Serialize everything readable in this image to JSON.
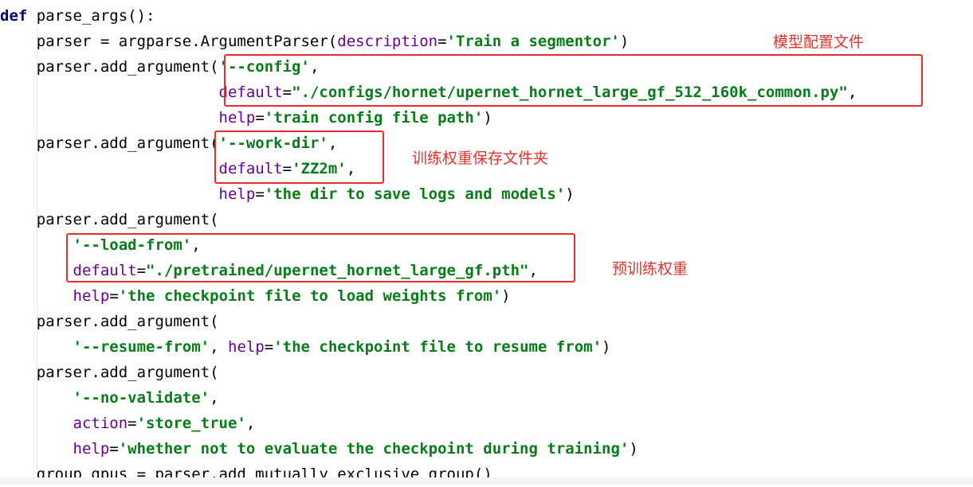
{
  "code_lines": [
    [
      {
        "t": "def",
        "c": "kw"
      },
      {
        "t": " parse_args():",
        "c": "plain"
      }
    ],
    [
      {
        "t": "    parser = argparse.ArgumentParser(",
        "c": "plain"
      },
      {
        "t": "description",
        "c": "kwarg"
      },
      {
        "t": "=",
        "c": "plain"
      },
      {
        "t": "'Train a segmentor'",
        "c": "str"
      },
      {
        "t": ")",
        "c": "plain"
      }
    ],
    [
      {
        "t": "    parser.add_argument(",
        "c": "plain"
      },
      {
        "t": "'--config'",
        "c": "str"
      },
      {
        "t": ",",
        "c": "plain"
      }
    ],
    [
      {
        "t": "                        ",
        "c": "plain"
      },
      {
        "t": "default",
        "c": "kwarg"
      },
      {
        "t": "=",
        "c": "plain"
      },
      {
        "t": "\"./configs/hornet/upernet_hornet_large_gf_512_160k_common.py\"",
        "c": "str"
      },
      {
        "t": ",",
        "c": "plain"
      }
    ],
    [
      {
        "t": "                        ",
        "c": "plain"
      },
      {
        "t": "help",
        "c": "kwarg"
      },
      {
        "t": "=",
        "c": "plain"
      },
      {
        "t": "'train config file path'",
        "c": "str"
      },
      {
        "t": ")",
        "c": "plain"
      }
    ],
    [
      {
        "t": "    parser.add_argument(",
        "c": "plain"
      },
      {
        "t": "'--work-dir'",
        "c": "str"
      },
      {
        "t": ",",
        "c": "plain"
      }
    ],
    [
      {
        "t": "                        ",
        "c": "plain"
      },
      {
        "t": "default",
        "c": "kwarg"
      },
      {
        "t": "=",
        "c": "plain"
      },
      {
        "t": "'ZZ2m'",
        "c": "str"
      },
      {
        "t": ",",
        "c": "plain"
      }
    ],
    [
      {
        "t": "                        ",
        "c": "plain"
      },
      {
        "t": "help",
        "c": "kwarg"
      },
      {
        "t": "=",
        "c": "plain"
      },
      {
        "t": "'the dir to save logs and models'",
        "c": "str"
      },
      {
        "t": ")",
        "c": "plain"
      }
    ],
    [
      {
        "t": "    parser.add_argument(",
        "c": "plain"
      }
    ],
    [
      {
        "t": "        ",
        "c": "plain"
      },
      {
        "t": "'--load-from'",
        "c": "str"
      },
      {
        "t": ",",
        "c": "plain"
      }
    ],
    [
      {
        "t": "        ",
        "c": "plain"
      },
      {
        "t": "default",
        "c": "kwarg"
      },
      {
        "t": "=",
        "c": "plain"
      },
      {
        "t": "\"./pretrained/upernet_hornet_large_gf.pth\"",
        "c": "str"
      },
      {
        "t": ",",
        "c": "plain"
      }
    ],
    [
      {
        "t": "        ",
        "c": "plain"
      },
      {
        "t": "help",
        "c": "kwarg"
      },
      {
        "t": "=",
        "c": "plain"
      },
      {
        "t": "'the checkpoint file to load weights from'",
        "c": "str"
      },
      {
        "t": ")",
        "c": "plain"
      }
    ],
    [
      {
        "t": "    parser.add_argument(",
        "c": "plain"
      }
    ],
    [
      {
        "t": "        ",
        "c": "plain"
      },
      {
        "t": "'--resume-from'",
        "c": "str"
      },
      {
        "t": ", ",
        "c": "plain"
      },
      {
        "t": "help",
        "c": "kwarg"
      },
      {
        "t": "=",
        "c": "plain"
      },
      {
        "t": "'the checkpoint file to resume from'",
        "c": "str"
      },
      {
        "t": ")",
        "c": "plain"
      }
    ],
    [
      {
        "t": "    parser.add_argument(",
        "c": "plain"
      }
    ],
    [
      {
        "t": "        ",
        "c": "plain"
      },
      {
        "t": "'--no-validate'",
        "c": "str"
      },
      {
        "t": ",",
        "c": "plain"
      }
    ],
    [
      {
        "t": "        ",
        "c": "plain"
      },
      {
        "t": "action",
        "c": "kwarg"
      },
      {
        "t": "=",
        "c": "plain"
      },
      {
        "t": "'store_true'",
        "c": "str"
      },
      {
        "t": ",",
        "c": "plain"
      }
    ],
    [
      {
        "t": "        ",
        "c": "plain"
      },
      {
        "t": "help",
        "c": "kwarg"
      },
      {
        "t": "=",
        "c": "plain"
      },
      {
        "t": "'whether not to evaluate the checkpoint during training'",
        "c": "str"
      },
      {
        "t": ")",
        "c": "plain"
      }
    ],
    [
      {
        "t": "    group_gpus = parser.add_mutually_exclusive_group()",
        "c": "plain"
      }
    ]
  ],
  "annotations": {
    "config": "模型配置文件",
    "work_dir": "训练权重保存文件夹",
    "load_from": "预训练权重"
  },
  "colors": {
    "keyword": "#000080",
    "string": "#067d17",
    "kwarg": "#660099",
    "highlight_box": "#e8302a"
  }
}
